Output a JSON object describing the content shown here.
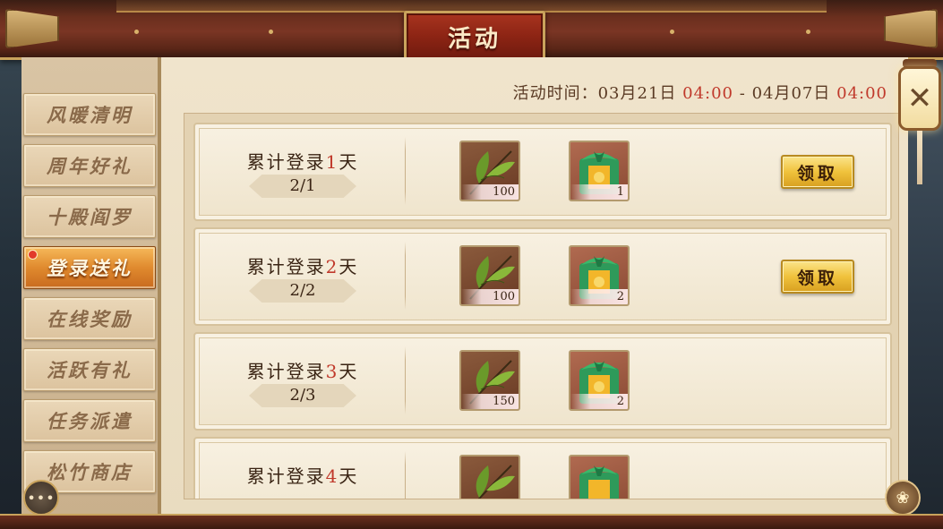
{
  "header": {
    "title": "活动"
  },
  "nav": {
    "items": [
      {
        "label": "风暖清明"
      },
      {
        "label": "周年好礼"
      },
      {
        "label": "十殿阎罗"
      },
      {
        "label": "登录送礼"
      },
      {
        "label": "在线奖励"
      },
      {
        "label": "活跃有礼"
      },
      {
        "label": "任务派遣"
      },
      {
        "label": "松竹商店"
      }
    ],
    "active_index": 3
  },
  "event_time": {
    "label": "活动时间：",
    "start_date": "03月21日",
    "start_time": "04:00",
    "separator": "-",
    "end_date": "04月07日",
    "end_time": "04:00"
  },
  "rows": [
    {
      "title_prefix": "累计登录",
      "days": "1",
      "title_suffix": "天",
      "progress": "2/1",
      "rewards": [
        {
          "icon": "tea-leaf-icon",
          "qty": "100"
        },
        {
          "icon": "gift-pack-icon",
          "qty": "1"
        }
      ],
      "claim_label": "领取"
    },
    {
      "title_prefix": "累计登录",
      "days": "2",
      "title_suffix": "天",
      "progress": "2/2",
      "rewards": [
        {
          "icon": "tea-leaf-icon",
          "qty": "100"
        },
        {
          "icon": "gift-pack-icon",
          "qty": "2"
        }
      ],
      "claim_label": "领取"
    },
    {
      "title_prefix": "累计登录",
      "days": "3",
      "title_suffix": "天",
      "progress": "2/3",
      "rewards": [
        {
          "icon": "tea-leaf-icon",
          "qty": "150"
        },
        {
          "icon": "gift-pack-icon",
          "qty": "2"
        }
      ]
    },
    {
      "title_prefix": "累计登录",
      "days": "4",
      "title_suffix": "天",
      "rewards": [
        {
          "icon": "tea-leaf-icon"
        },
        {
          "icon": "gift-pack-icon"
        }
      ]
    }
  ],
  "icons": {
    "close": "close-icon",
    "chat": "chat-bubble-icon",
    "corner": "tea-cup-icon"
  },
  "colors": {
    "highlight_red": "#c0392b",
    "active_tab": "#e08a2e",
    "claim_gold": "#f0c23c"
  }
}
